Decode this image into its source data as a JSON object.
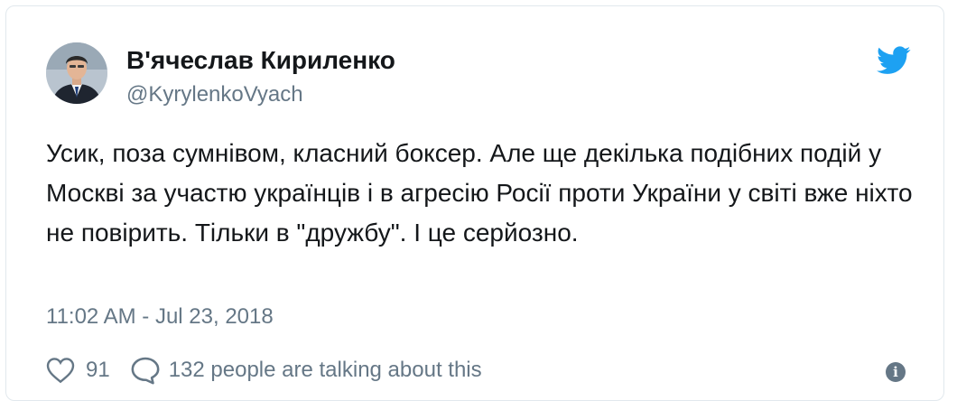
{
  "tweet": {
    "author_name": "В'ячеслав Кириленко",
    "author_handle": "@KyrylenkoVyach",
    "text": "Усик, поза сумнівом, класний боксер. Але ще декілька подібних подій у Москві за участю українців і в агресію Росії проти України у світі вже ніхто не повірить. Тільки в \"дружбу\". І це серйозно.",
    "timestamp": "11:02 AM - Jul 23, 2018",
    "likes": "91",
    "conversation": "132 people are talking about this"
  },
  "icons": {
    "brand": "twitter-bird-icon",
    "like": "heart-icon",
    "reply": "speech-bubble-icon",
    "info": "info-icon"
  },
  "colors": {
    "brand": "#1da1f2",
    "text": "#14171a",
    "secondary": "#657786",
    "border": "#e1e8ed"
  }
}
